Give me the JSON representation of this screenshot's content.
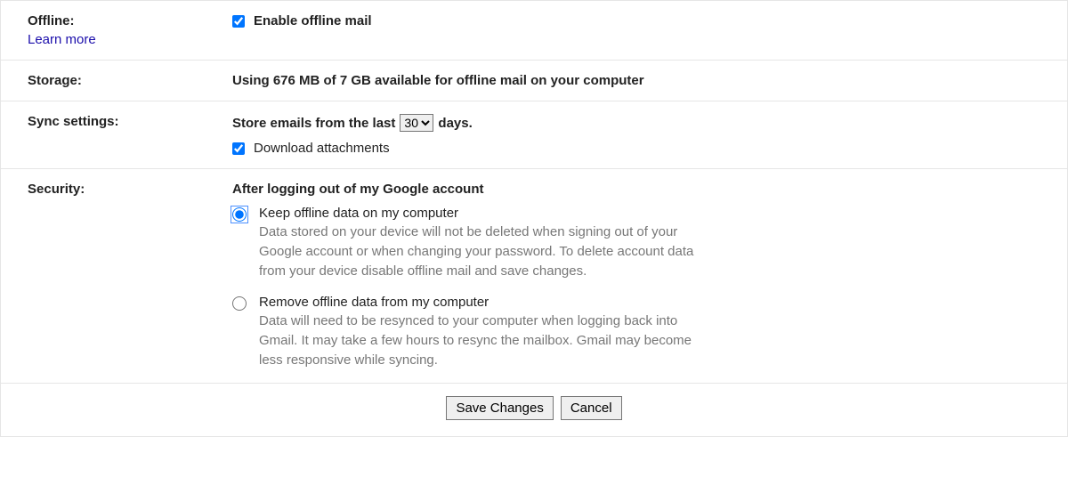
{
  "offline": {
    "label": "Offline:",
    "learn_more": "Learn more",
    "enable_label": "Enable offline mail",
    "enable_checked": true
  },
  "storage": {
    "label": "Storage:",
    "text": "Using 676 MB of 7 GB available for offline mail on your computer"
  },
  "sync": {
    "label": "Sync settings:",
    "prefix": "Store emails from the last",
    "selected": "30",
    "suffix": "days.",
    "attachments_label": "Download attachments",
    "attachments_checked": true
  },
  "security": {
    "label": "Security:",
    "heading": "After logging out of my Google account",
    "options": [
      {
        "title": "Keep offline data on my computer",
        "desc": "Data stored on your device will not be deleted when signing out of your Google account or when changing your password. To delete account data from your device disable offline mail and save changes.",
        "selected": true
      },
      {
        "title": "Remove offline data from my computer",
        "desc": "Data will need to be resynced to your computer when logging back into Gmail. It may take a few hours to resync the mailbox. Gmail may become less responsive while syncing.",
        "selected": false
      }
    ]
  },
  "buttons": {
    "save": "Save Changes",
    "cancel": "Cancel"
  }
}
